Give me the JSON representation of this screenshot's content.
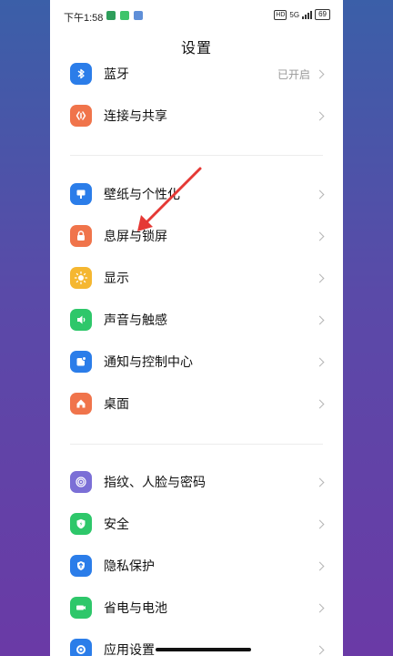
{
  "status_bar": {
    "time": "下午1:58",
    "app_icons": [
      "#2e9e5b",
      "#3fc46a",
      "#5f8fd8"
    ],
    "hd": "HD",
    "network": "5G",
    "battery": "69"
  },
  "header": {
    "title": "设置"
  },
  "groups": [
    {
      "items": [
        {
          "label": "蓝牙",
          "value": "已开启",
          "icon": "bluetooth-icon",
          "color": "#2b7de9"
        },
        {
          "label": "连接与共享",
          "value": "",
          "icon": "connection-icon",
          "color": "#f0744b"
        }
      ]
    },
    {
      "items": [
        {
          "label": "壁纸与个性化",
          "value": "",
          "icon": "wallpaper-icon",
          "color": "#2b7de9"
        },
        {
          "label": "息屏与锁屏",
          "value": "",
          "icon": "lock-icon",
          "color": "#f0744b"
        },
        {
          "label": "显示",
          "value": "",
          "icon": "sun-icon",
          "color": "#f5b731"
        },
        {
          "label": "声音与触感",
          "value": "",
          "icon": "sound-icon",
          "color": "#2ec76a"
        },
        {
          "label": "通知与控制中心",
          "value": "",
          "icon": "notification-icon",
          "color": "#2b7de9"
        },
        {
          "label": "桌面",
          "value": "",
          "icon": "home-icon",
          "color": "#f0744b"
        }
      ]
    },
    {
      "items": [
        {
          "label": "指纹、人脸与密码",
          "value": "",
          "icon": "fingerprint-icon",
          "color": "#7b6fd6"
        },
        {
          "label": "安全",
          "value": "",
          "icon": "shield-icon",
          "color": "#2ec76a"
        },
        {
          "label": "隐私保护",
          "value": "",
          "icon": "privacy-icon",
          "color": "#2b7de9"
        },
        {
          "label": "省电与电池",
          "value": "",
          "icon": "battery-icon",
          "color": "#2ec76a"
        },
        {
          "label": "应用设置",
          "value": "",
          "icon": "app-settings-icon",
          "color": "#2b7de9"
        }
      ]
    }
  ],
  "annotation": {
    "arrow_color": "#e53935"
  }
}
